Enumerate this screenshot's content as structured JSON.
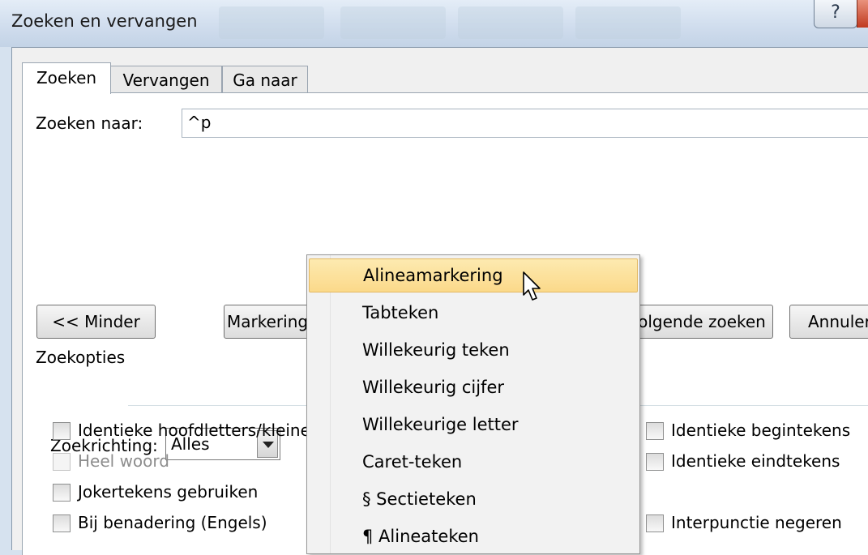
{
  "window": {
    "title": "Zoeken en vervangen",
    "help_label": "?"
  },
  "tabs": [
    {
      "label": "Zoeken",
      "active": true
    },
    {
      "label": "Vervangen",
      "active": false
    },
    {
      "label": "Ga naar",
      "active": false
    }
  ],
  "search": {
    "label": "Zoeken naar:",
    "value": "^p"
  },
  "buttons": {
    "less": "<< Minder",
    "marking": "Markering",
    "find_next": "Volgende zoeken",
    "cancel": "Annuleren"
  },
  "options": {
    "group_label": "Zoekopties",
    "direction_label": "Zoekrichting:",
    "direction_value": "Alles",
    "left": [
      {
        "label": "Identieke hoofdletters/kleine letters",
        "checked": false,
        "disabled": false
      },
      {
        "label": "Heel woord",
        "checked": false,
        "disabled": true
      },
      {
        "label": "Jokertekens gebruiken",
        "checked": false,
        "disabled": false
      },
      {
        "label": "Bij benadering (Engels)",
        "checked": false,
        "disabled": false
      }
    ],
    "right": [
      {
        "label": "Identieke begintekens",
        "checked": false
      },
      {
        "label": "Identieke eindtekens",
        "checked": false
      },
      {
        "label": "Interpunctie negeren",
        "checked": false
      }
    ]
  },
  "menu": {
    "items": [
      {
        "label": "Alineamarkering",
        "highlighted": true
      },
      {
        "label": "Tabteken",
        "highlighted": false
      },
      {
        "label": "Willekeurig teken",
        "highlighted": false
      },
      {
        "label": "Willekeurig cijfer",
        "highlighted": false
      },
      {
        "label": "Willekeurige letter",
        "highlighted": false
      },
      {
        "label": "Caret-teken",
        "highlighted": false
      },
      {
        "label": "§ Sectieteken",
        "highlighted": false
      },
      {
        "label": "¶ Alineateken",
        "highlighted": false
      }
    ]
  },
  "colors": {
    "highlight": "#fbd98a",
    "titlebar": "#cfdced",
    "close_button": "#c0391f"
  }
}
